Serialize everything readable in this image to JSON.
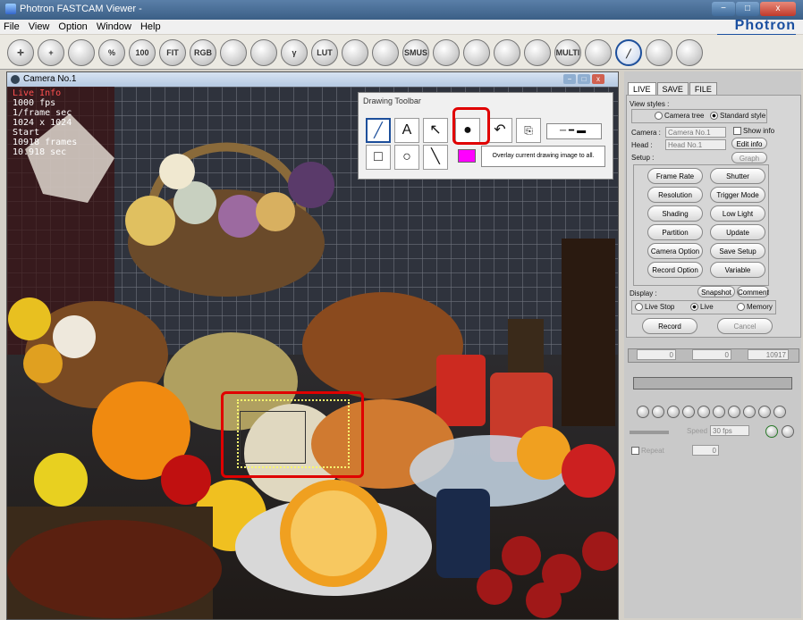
{
  "window": {
    "title": "Photron FASTCAM Viewer -",
    "brand": "Photron",
    "controls": [
      "−",
      "□",
      "x"
    ]
  },
  "menu": [
    "File",
    "View",
    "Option",
    "Window",
    "Help"
  ],
  "toolbar": {
    "buttons": [
      {
        "name": "move-icon",
        "label": "✛"
      },
      {
        "name": "zoom-in-icon",
        "label": "+"
      },
      {
        "name": "fit-window-icon",
        "label": ""
      },
      {
        "name": "percent-icon",
        "label": "%"
      },
      {
        "name": "zoom-100-icon",
        "label": "100"
      },
      {
        "name": "fit-icon",
        "label": "FIT"
      },
      {
        "name": "rgb-icon",
        "label": "RGB"
      },
      {
        "name": "contrast-icon",
        "label": ""
      },
      {
        "name": "brightness-icon",
        "label": ""
      },
      {
        "name": "gamma-icon",
        "label": "γ"
      },
      {
        "name": "lut-reset-icon",
        "label": "LUT"
      },
      {
        "name": "square-icon",
        "label": ""
      },
      {
        "name": "black-icon",
        "label": ""
      },
      {
        "name": "smooth-icon",
        "label": "SMUS"
      },
      {
        "name": "frame-icon",
        "label": ""
      },
      {
        "name": "grid-icon",
        "label": ""
      },
      {
        "name": "rotate-icon",
        "label": ""
      },
      {
        "name": "settings-icon",
        "label": ""
      },
      {
        "name": "multi-icon",
        "label": "MULTI"
      },
      {
        "name": "tuning-fork-icon",
        "label": ""
      },
      {
        "name": "pen-icon",
        "label": "╱"
      },
      {
        "name": "keyboard-icon",
        "label": ""
      },
      {
        "name": "disk-icon",
        "label": ""
      }
    ]
  },
  "camera": {
    "title": "Camera No.1",
    "info": {
      "line1": "Live Info",
      "line2": "1000 fps",
      "line3": "1/frame sec",
      "line4": "1024 x 1024",
      "line5": "Start",
      "line6": "10918 frames",
      "line7": "10.918 sec"
    },
    "win_controls": [
      "−",
      "□",
      "x"
    ]
  },
  "drawing_toolbar": {
    "title": "Drawing Toolbar",
    "tools_row1": [
      "╱",
      "A",
      "↖",
      "●",
      "↶",
      "⎘"
    ],
    "tools_row2": [
      "□",
      "○",
      "╲"
    ],
    "line_styles": [
      "─",
      "━",
      "▬"
    ],
    "overlay_label": "Overlay current drawing image to all.",
    "color": "#ff00ff"
  },
  "right_panel": {
    "tabs": [
      "LIVE",
      "SAVE",
      "FILE"
    ],
    "view_styles_label": "View styles :",
    "style_camera_tree": "Camera tree",
    "style_standard": "Standard style",
    "camera_label": "Camera :",
    "camera_value": "Camera No.1",
    "head_label": "Head :",
    "head_value": "Head No.1",
    "setup_label": "Setup :",
    "show_info": "Show info",
    "edit_info": "Edit info",
    "graph": "Graph",
    "setup_buttons": [
      "Frame Rate",
      "Shutter",
      "Resolution",
      "Trigger Mode",
      "Shading",
      "Low Light",
      "Partition",
      "Update",
      "Camera Option",
      "Save Setup",
      "Record Option",
      "Variable"
    ],
    "display_label": "Display :",
    "snapshot": "Snapshot",
    "comment": "Comment",
    "live_stop": "Live Stop",
    "live": "Live",
    "memory": "Memory",
    "record": "Record",
    "cancel": "Cancel",
    "frame_start": "0",
    "frame_cur": "0",
    "frame_end": "10917",
    "speed_label": "Speed",
    "speed_value": "30 fps",
    "repeat": "Repeat",
    "repeat_value": "0"
  }
}
